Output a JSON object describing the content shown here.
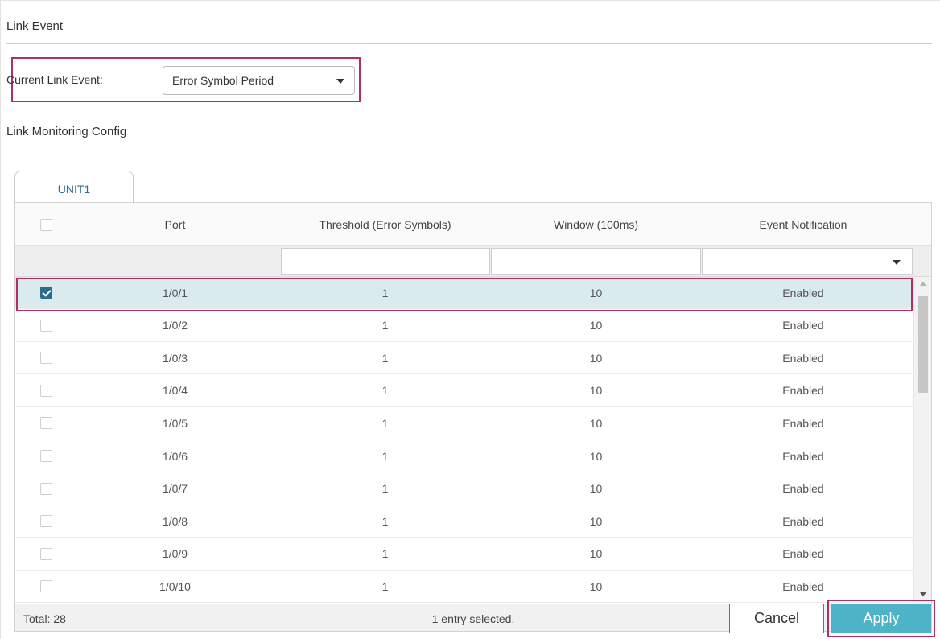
{
  "link_event": {
    "section_title": "Link Event",
    "current_label": "Current Link Event:",
    "current_value": "Error Symbol Period"
  },
  "monitoring": {
    "section_title": "Link Monitoring Config",
    "tab_label": "UNIT1"
  },
  "table": {
    "columns": [
      "Port",
      "Threshold (Error Symbols)",
      "Window (100ms)",
      "Event Notification"
    ],
    "rows": [
      {
        "port": "1/0/1",
        "threshold": "1",
        "window": "10",
        "notification": "Enabled",
        "checked": true
      },
      {
        "port": "1/0/2",
        "threshold": "1",
        "window": "10",
        "notification": "Enabled",
        "checked": false
      },
      {
        "port": "1/0/3",
        "threshold": "1",
        "window": "10",
        "notification": "Enabled",
        "checked": false
      },
      {
        "port": "1/0/4",
        "threshold": "1",
        "window": "10",
        "notification": "Enabled",
        "checked": false
      },
      {
        "port": "1/0/5",
        "threshold": "1",
        "window": "10",
        "notification": "Enabled",
        "checked": false
      },
      {
        "port": "1/0/6",
        "threshold": "1",
        "window": "10",
        "notification": "Enabled",
        "checked": false
      },
      {
        "port": "1/0/7",
        "threshold": "1",
        "window": "10",
        "notification": "Enabled",
        "checked": false
      },
      {
        "port": "1/0/8",
        "threshold": "1",
        "window": "10",
        "notification": "Enabled",
        "checked": false
      },
      {
        "port": "1/0/9",
        "threshold": "1",
        "window": "10",
        "notification": "Enabled",
        "checked": false
      },
      {
        "port": "1/0/10",
        "threshold": "1",
        "window": "10",
        "notification": "Enabled",
        "checked": false
      }
    ],
    "footer_total": "Total: 28",
    "footer_selected": "1 entry selected."
  },
  "buttons": {
    "cancel": "Cancel",
    "apply": "Apply"
  },
  "colors": {
    "accent": "#4db3c6",
    "highlight_border": "#b42d66",
    "selected_row": "#d9ebef",
    "tab_text": "#2b6e8a"
  },
  "icons": {
    "select_caret": "chevron-down-icon",
    "checkbox": "checkbox-icon",
    "scroll_up": "arrow-up-icon",
    "scroll_down": "arrow-down-icon"
  }
}
